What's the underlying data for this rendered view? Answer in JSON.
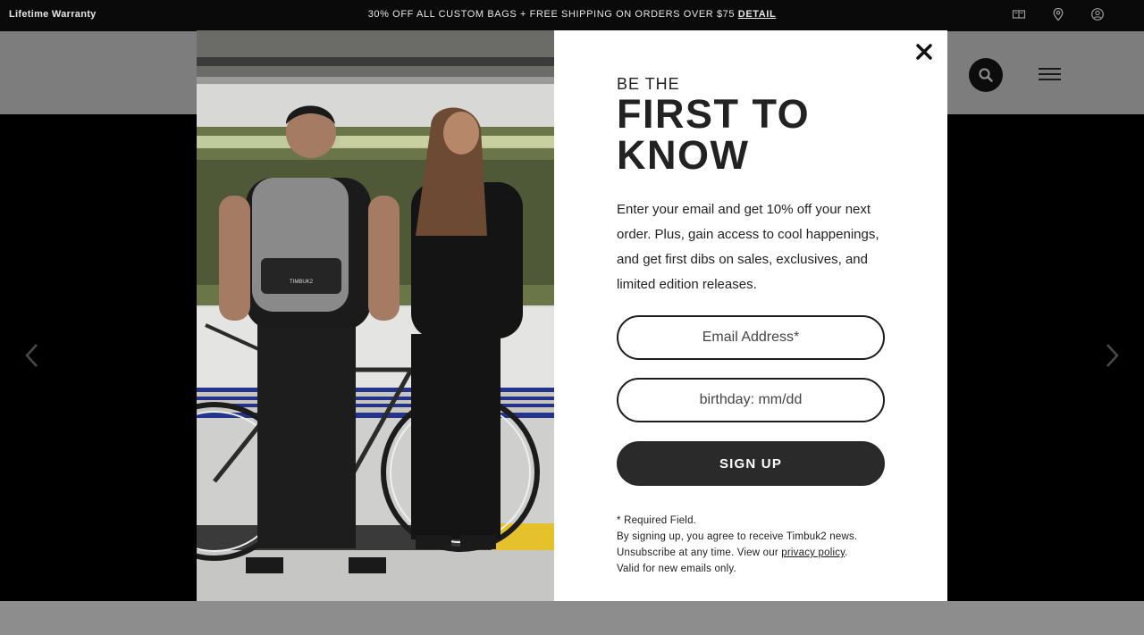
{
  "topbar": {
    "left_label": "Lifetime Warranty",
    "promo_text": "30% OFF ALL CUSTOM BAGS + FREE SHIPPING ON ORDERS OVER $75",
    "promo_link": "DETAIL",
    "icons": [
      "book-icon",
      "location-pin-icon",
      "account-icon"
    ]
  },
  "header": {
    "icons": [
      "search-icon",
      "hamburger-menu-icon"
    ]
  },
  "hero": {
    "icons": [
      "chevron-left-icon",
      "chevron-right-icon"
    ]
  },
  "modal": {
    "eyebrow": "BE THE",
    "headline_line1": "FIRST TO",
    "headline_line2": "KNOW",
    "description": "Enter your email and get 10% off your next order. Plus, gain access to cool happenings, and get first dibs on sales, exclusives, and limited edition releases.",
    "email_placeholder": "Email Address*",
    "birthday_placeholder": "birthday: mm/dd",
    "signup_label": "SIGN UP",
    "fine_required": "* Required Field.",
    "fine_agree": "By signing up, you agree to receive Timbuk2 news.",
    "fine_unsub_prefix": "Unsubscribe at any time. View our ",
    "fine_privacy_link": "privacy policy",
    "fine_unsub_suffix": ".",
    "fine_valid": "Valid for new emails only.",
    "backpack_brand": "TIMBUK2"
  },
  "colors": {
    "topbar_bg": "#0a0a0a",
    "button_dark": "#2a2a2a",
    "overlay_gray": "#7d7d7d"
  }
}
